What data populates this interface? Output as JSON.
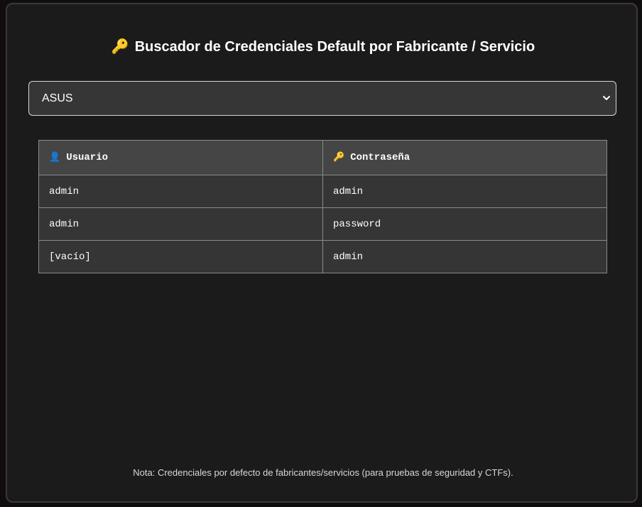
{
  "title": {
    "icon": "key-icon",
    "icon_glyph": "🔑",
    "text": "Buscador de Credenciales Default por Fabricante / Servicio"
  },
  "vendor_select": {
    "selected": "ASUS",
    "icon": "chevron-down-icon"
  },
  "table": {
    "headers": [
      {
        "icon": "user-icon",
        "icon_glyph": "👤",
        "label": "Usuario"
      },
      {
        "icon": "key-icon",
        "icon_glyph": "🔑",
        "label": "Contraseña"
      }
    ],
    "rows": [
      {
        "user": "admin",
        "password": "admin"
      },
      {
        "user": "admin",
        "password": "password"
      },
      {
        "user": "[vacío]",
        "password": "admin"
      }
    ]
  },
  "note": "Nota: Credenciales por defecto de fabricantes/servicios (para pruebas de seguridad y CTFs).",
  "colors": {
    "panel_bg": "#1b1b1b",
    "header_bg": "#454545",
    "cell_bg": "#353535",
    "key_gold": "#e8b33a"
  }
}
